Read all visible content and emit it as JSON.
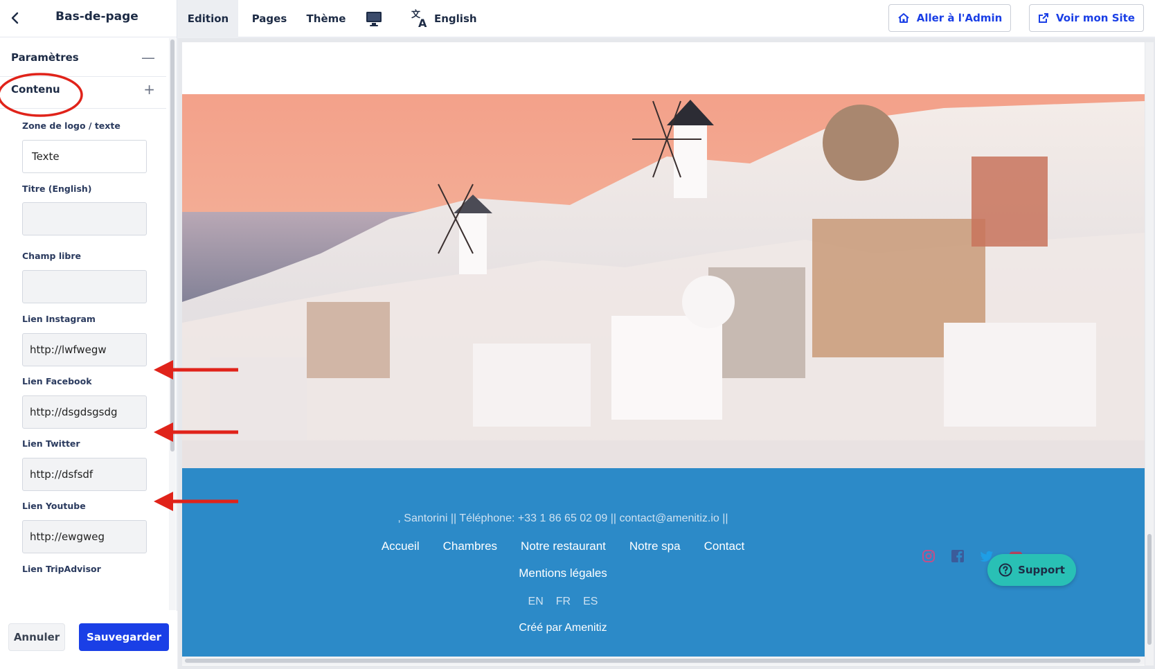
{
  "sidebar": {
    "back_icon": "chevron-left-icon",
    "title": "Bas-de-page",
    "sections": [
      {
        "label": "Paramètres",
        "sign": "—"
      },
      {
        "label": "Contenu",
        "sign": "+"
      }
    ],
    "fields": [
      {
        "label": "Zone de logo / texte",
        "value": "Texte"
      },
      {
        "label": "Titre (English)",
        "value": ""
      },
      {
        "label": "Champ libre",
        "value": ""
      },
      {
        "label": "Lien Instagram",
        "value": "http://lwfwegw"
      },
      {
        "label": "Lien Facebook",
        "value": "http://dsgdsgsdg"
      },
      {
        "label": "Lien Twitter",
        "value": "http://dsfsdf"
      },
      {
        "label": "Lien Youtube",
        "value": "http://ewgweg"
      },
      {
        "label": "Lien TripAdvisor",
        "value": ""
      }
    ],
    "cancel_label": "Annuler",
    "save_label": "Sauvegarder"
  },
  "topbar": {
    "tabs": [
      "Edition",
      "Pages",
      "Thème"
    ],
    "device_icon": "desktop-monitor-icon",
    "language_icon": "translate-icon",
    "language": "English",
    "admin_button": "Aller à l'Admin",
    "site_button": "Voir mon Site"
  },
  "preview": {
    "hero_image": "Santorini village at sunset with windmills",
    "footer": {
      "contact_line": ", Santorini   ||   Téléphone: +33 1 86 65 02 09   ||   contact@amenitiz.io   ||",
      "nav": [
        "Accueil",
        "Chambres",
        "Notre restaurant",
        "Notre spa",
        "Contact"
      ],
      "legal": "Mentions légales",
      "languages": [
        "EN",
        "FR",
        "ES"
      ],
      "credit": "Créé par Amenitiz",
      "social_icons": [
        "instagram-icon",
        "facebook-icon",
        "twitter-icon",
        "youtube-icon"
      ]
    }
  },
  "support_label": "Support",
  "colors": {
    "primary": "#1a3fe6",
    "footer_bg": "#2c8ac8",
    "support_bg": "#29c0b5",
    "annotation_red": "#e0231a"
  }
}
